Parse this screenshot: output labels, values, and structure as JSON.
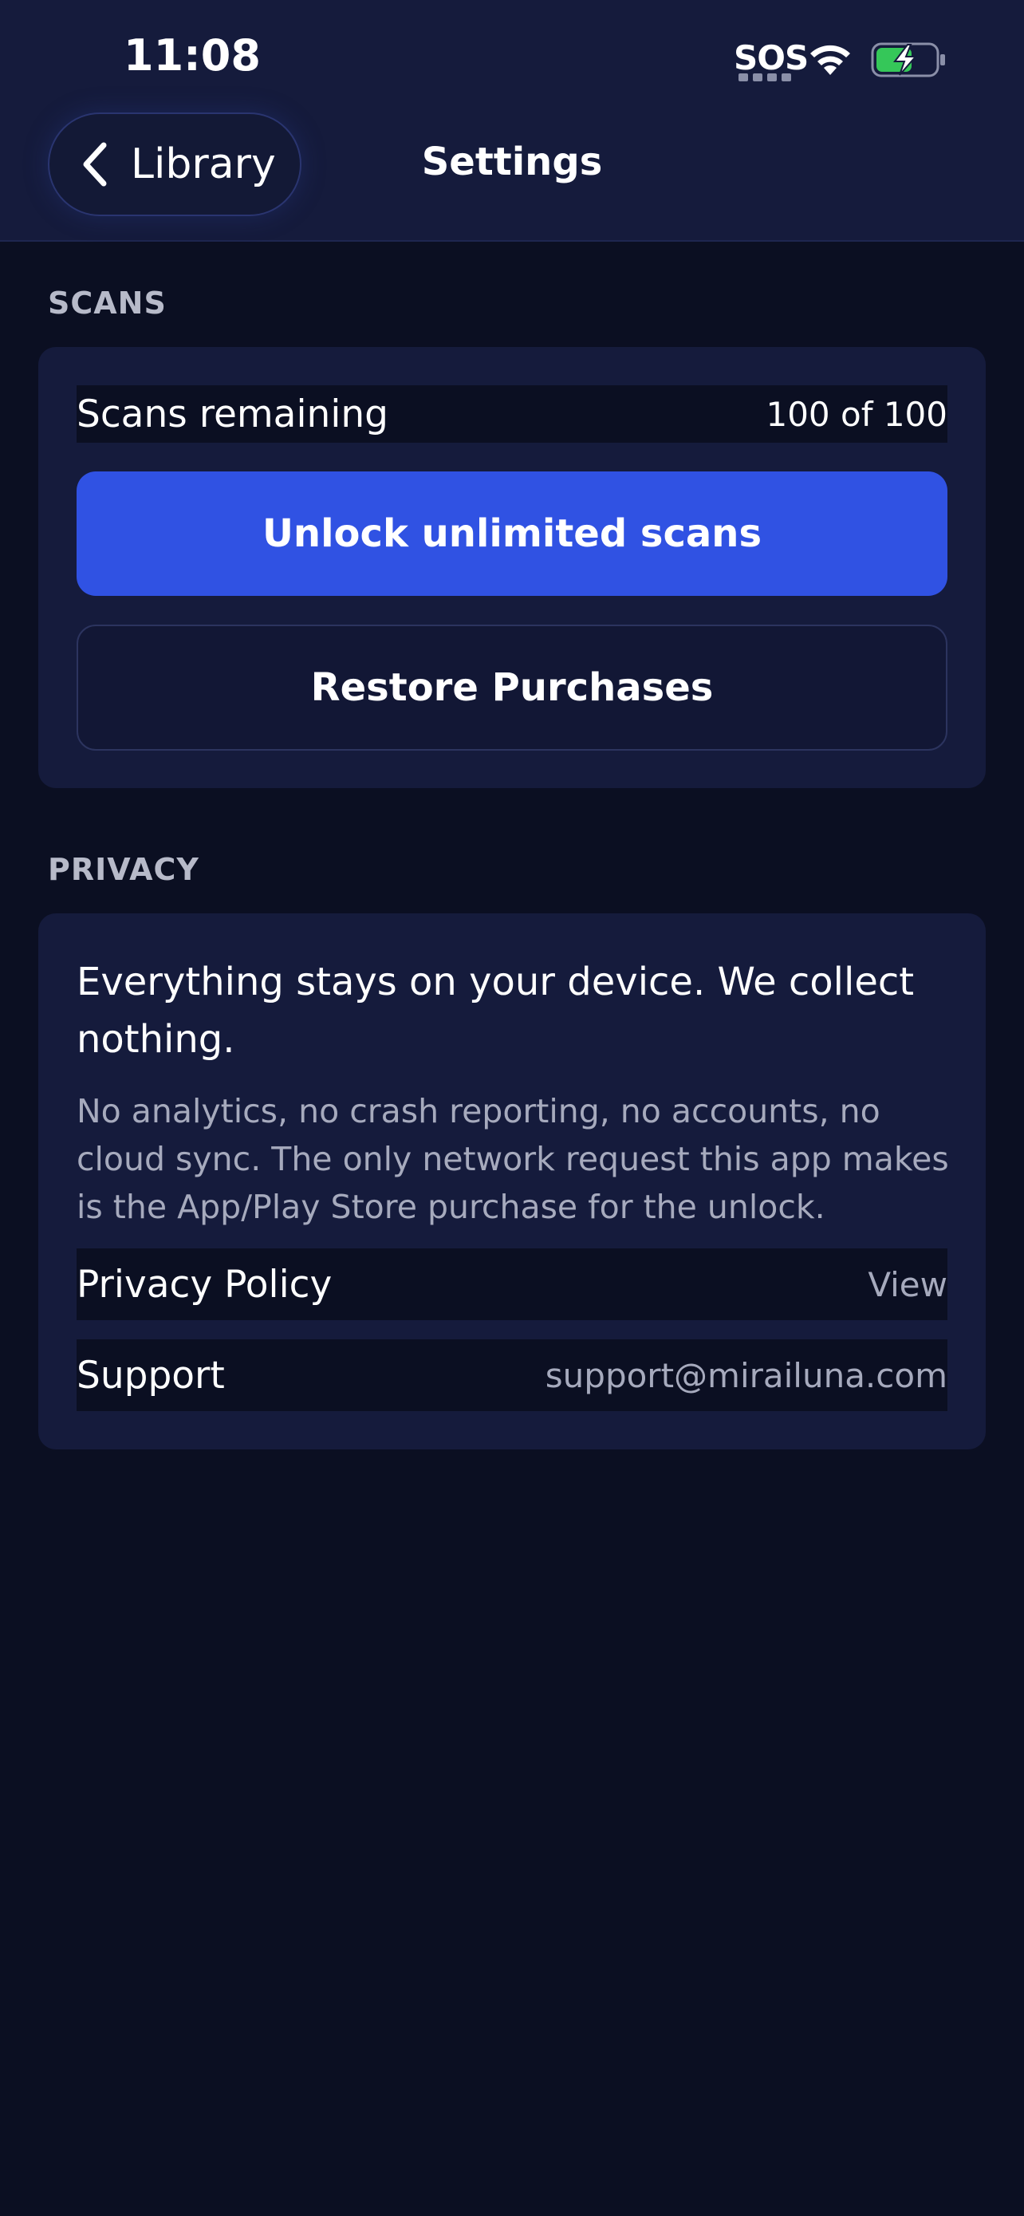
{
  "status_bar": {
    "time": "11:08",
    "sos": "SOS",
    "icons": [
      "wifi-icon",
      "battery-charging-icon"
    ],
    "battery_color": "#35c759"
  },
  "nav": {
    "back_label": "Library",
    "title": "Settings"
  },
  "scans_section": {
    "header": "SCANS",
    "remaining_label": "Scans remaining",
    "remaining_value": "100 of 100",
    "unlock_label": "Unlock unlimited scans",
    "restore_label": "Restore Purchases"
  },
  "privacy_section": {
    "header": "PRIVACY",
    "headline": "Everything stays on your device. We collect nothing.",
    "body": "No analytics, no crash reporting, no accounts, no cloud sync. The only network request this app makes is the App/Play Store purchase for the unlock.",
    "policy_label": "Privacy Policy",
    "policy_value": "View",
    "support_label": "Support",
    "support_value": "support@mirailuna.com"
  },
  "colors": {
    "background": "#0b0f22",
    "card": "#151b3c",
    "accent": "#3052e3",
    "muted_text": "#a6aabd"
  }
}
